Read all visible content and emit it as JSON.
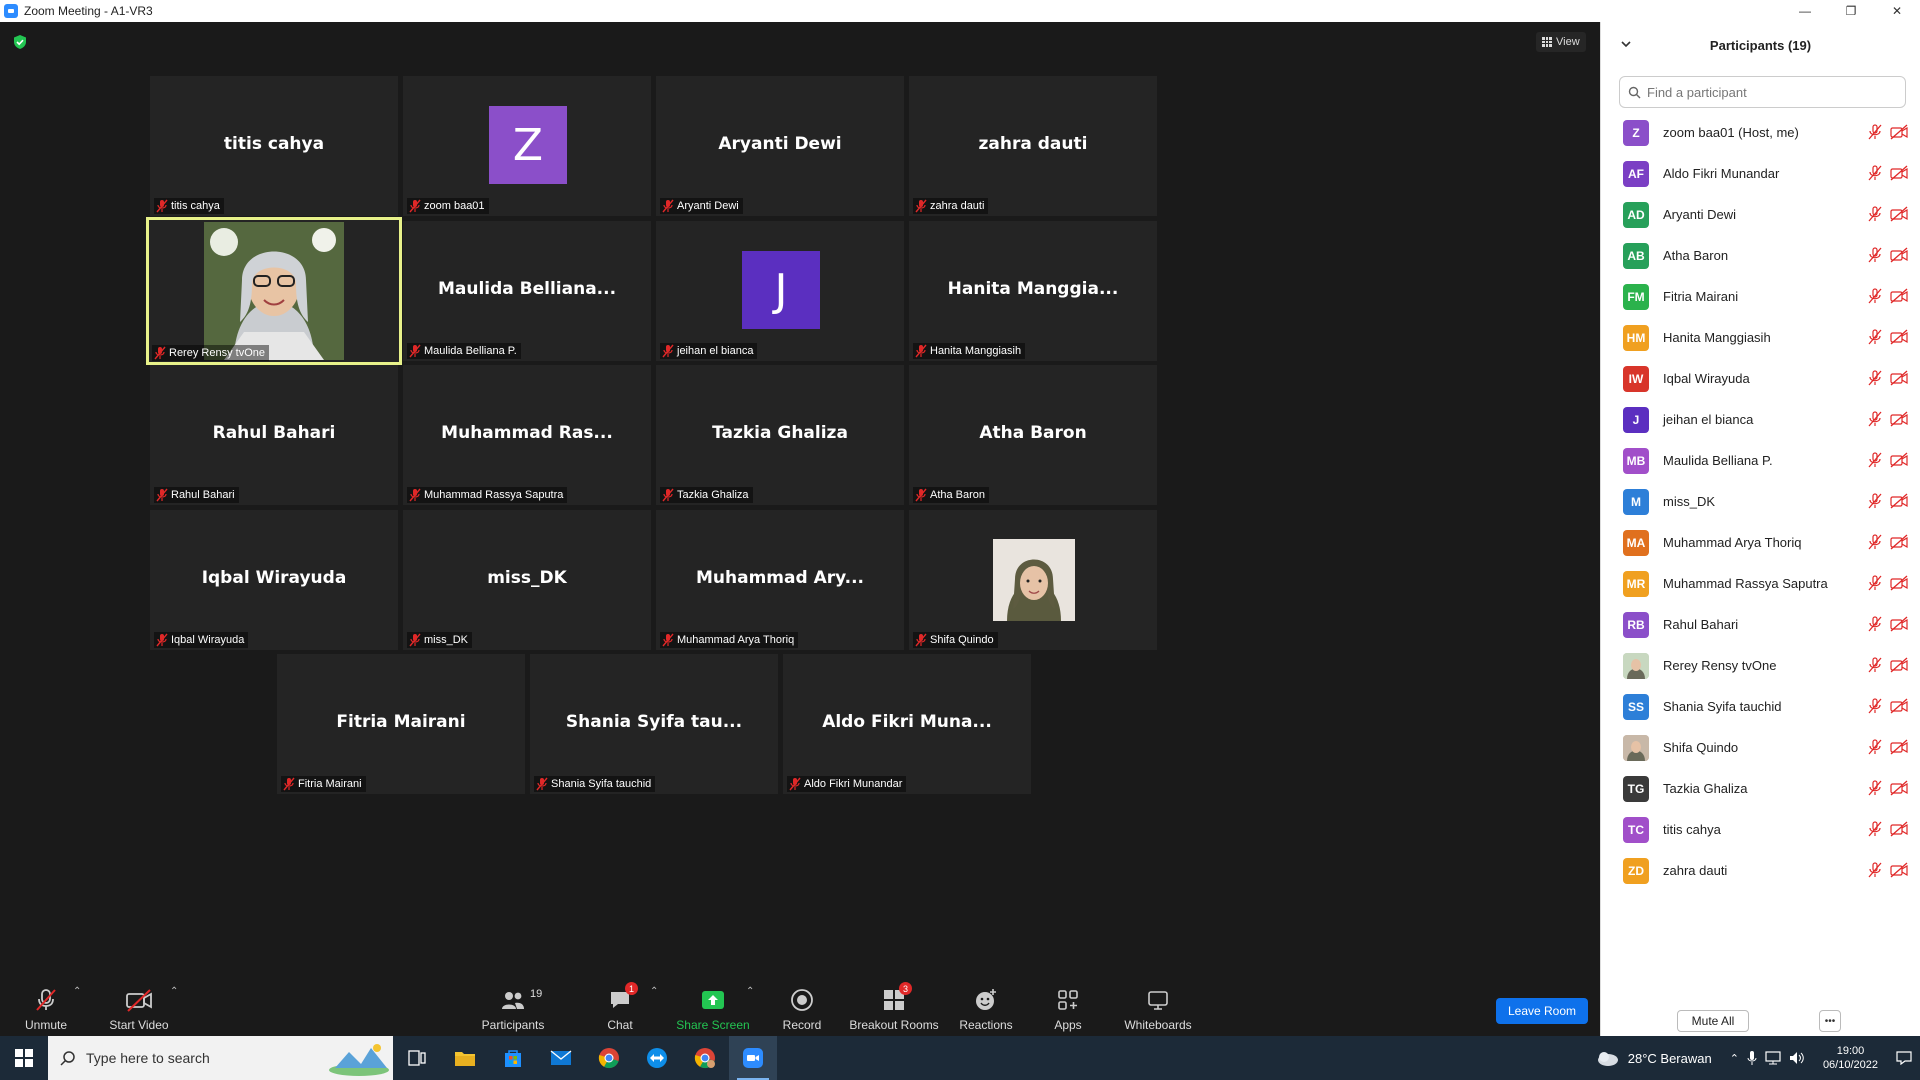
{
  "window": {
    "title": "Zoom Meeting - A1-VR3"
  },
  "meeting": {
    "view_label": "View",
    "tiles": [
      {
        "big": "titis cahya",
        "foot": "titis cahya"
      },
      {
        "big": "",
        "foot": "zoom baa01",
        "avatar": "Z",
        "avatar_color": "#8b4fc9"
      },
      {
        "big": "Aryanti Dewi",
        "foot": "Aryanti Dewi"
      },
      {
        "big": "zahra dauti",
        "foot": "zahra dauti"
      },
      {
        "big": "",
        "foot": "Rerey Rensy tvOne"
      },
      {
        "big": "Maulida  Belliana...",
        "foot": "Maulida Belliana P."
      },
      {
        "big": "",
        "foot": "jeihan el bianca",
        "avatar": "J",
        "avatar_color": "#5b2fc0"
      },
      {
        "big": "Hanita  Manggia...",
        "foot": "Hanita Manggiasih"
      },
      {
        "big": "Rahul Bahari",
        "foot": "Rahul Bahari"
      },
      {
        "big": "Muhammad  Ras...",
        "foot": "Muhammad Rassya Saputra"
      },
      {
        "big": "Tazkia Ghaliza",
        "foot": "Tazkia Ghaliza"
      },
      {
        "big": "Atha Baron",
        "foot": "Atha Baron"
      },
      {
        "big": "Iqbal Wirayuda",
        "foot": "Iqbal Wirayuda"
      },
      {
        "big": "miss_DK",
        "foot": "miss_DK"
      },
      {
        "big": "Muhammad  Ary...",
        "foot": "Muhammad Arya Thoriq"
      },
      {
        "big": "",
        "foot": "Shifa Quindo"
      },
      {
        "big": "Fitria Mairani",
        "foot": "Fitria Mairani"
      },
      {
        "big": "Shania  Syifa  tau...",
        "foot": "Shania Syifa tauchid"
      },
      {
        "big": "Aldo  Fikri  Muna...",
        "foot": "Aldo Fikri Munandar"
      }
    ]
  },
  "toolbar": {
    "unmute": "Unmute",
    "start_video": "Start Video",
    "participants": "Participants",
    "participants_count": "19",
    "chat": "Chat",
    "chat_badge": "1",
    "share_screen": "Share Screen",
    "record": "Record",
    "breakout_rooms": "Breakout Rooms",
    "breakout_badge": "3",
    "reactions": "Reactions",
    "apps": "Apps",
    "whiteboards": "Whiteboards",
    "leave": "Leave Room"
  },
  "panel": {
    "title": "Participants (19)",
    "search_placeholder": "Find a participant",
    "mute_all": "Mute All",
    "participants": [
      {
        "initials": "Z",
        "name": "zoom baa01 (Host, me)",
        "color": "#8b4fc9"
      },
      {
        "initials": "AF",
        "name": "Aldo Fikri Munandar",
        "color": "#7b3fc4"
      },
      {
        "initials": "AD",
        "name": "Aryanti Dewi",
        "color": "#27a05a"
      },
      {
        "initials": "AB",
        "name": "Atha Baron",
        "color": "#27a05a"
      },
      {
        "initials": "FM",
        "name": "Fitria Mairani",
        "color": "#2bb24c"
      },
      {
        "initials": "HM",
        "name": "Hanita Manggiasih",
        "color": "#f0a020"
      },
      {
        "initials": "IW",
        "name": "Iqbal Wirayuda",
        "color": "#d8352a"
      },
      {
        "initials": "J",
        "name": "jeihan el bianca",
        "color": "#5b2fc0"
      },
      {
        "initials": "MB",
        "name": "Maulida Belliana P.",
        "color": "#a14fc9"
      },
      {
        "initials": "M",
        "name": "miss_DK",
        "color": "#2d7fd8"
      },
      {
        "initials": "MA",
        "name": "Muhammad Arya Thoriq",
        "color": "#e0701e"
      },
      {
        "initials": "MR",
        "name": "Muhammad Rassya Saputra",
        "color": "#f0a020"
      },
      {
        "initials": "RB",
        "name": "Rahul Bahari",
        "color": "#8b4fc9"
      },
      {
        "initials": "",
        "name": "Rerey Rensy tvOne",
        "color": "#c8d8c0"
      },
      {
        "initials": "SS",
        "name": "Shania Syifa tauchid",
        "color": "#2d7fd8"
      },
      {
        "initials": "",
        "name": "Shifa Quindo",
        "color": "#c8b8a8"
      },
      {
        "initials": "TG",
        "name": "Tazkia Ghaliza",
        "color": "#3a3a3a"
      },
      {
        "initials": "TC",
        "name": "titis cahya",
        "color": "#a14fc9"
      },
      {
        "initials": "ZD",
        "name": "zahra dauti",
        "color": "#f0a020"
      }
    ]
  },
  "taskbar": {
    "search_placeholder": "Type here to search",
    "weather": "28°C  Berawan",
    "time": "19:00",
    "date": "06/10/2022"
  },
  "colors": {
    "active_speaker": "#e8f28a",
    "leave_button": "#0e71eb",
    "mic_off": "#e02828",
    "share_green": "#23c552"
  }
}
